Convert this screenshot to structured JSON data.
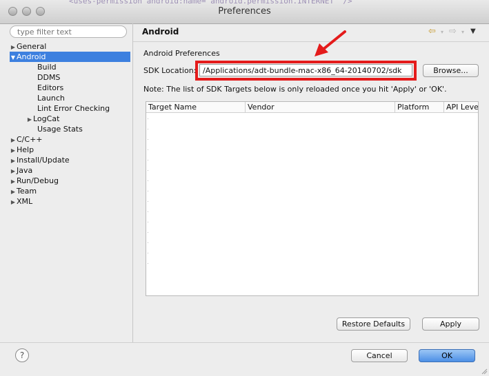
{
  "window": {
    "title": "Preferences",
    "background_code": "<uses-permission android:name=\"android.permission.INTERNET\" />"
  },
  "filter": {
    "placeholder": "type filter text"
  },
  "tree": [
    {
      "label": "General",
      "expander": "collapsed",
      "level": 0,
      "selected": false
    },
    {
      "label": "Android",
      "expander": "expanded",
      "level": 0,
      "selected": true
    },
    {
      "label": "Build",
      "expander": "none",
      "level": 1,
      "selected": false
    },
    {
      "label": "DDMS",
      "expander": "none",
      "level": 1,
      "selected": false
    },
    {
      "label": "Editors",
      "expander": "none",
      "level": 1,
      "selected": false
    },
    {
      "label": "Launch",
      "expander": "none",
      "level": 1,
      "selected": false
    },
    {
      "label": "Lint Error Checking",
      "expander": "none",
      "level": 1,
      "selected": false
    },
    {
      "label": "LogCat",
      "expander": "collapsed",
      "level": 1,
      "selected": false
    },
    {
      "label": "Usage Stats",
      "expander": "none",
      "level": 1,
      "selected": false
    },
    {
      "label": "C/C++",
      "expander": "collapsed",
      "level": 0,
      "selected": false
    },
    {
      "label": "Help",
      "expander": "collapsed",
      "level": 0,
      "selected": false
    },
    {
      "label": "Install/Update",
      "expander": "collapsed",
      "level": 0,
      "selected": false
    },
    {
      "label": "Java",
      "expander": "collapsed",
      "level": 0,
      "selected": false
    },
    {
      "label": "Run/Debug",
      "expander": "collapsed",
      "level": 0,
      "selected": false
    },
    {
      "label": "Team",
      "expander": "collapsed",
      "level": 0,
      "selected": false
    },
    {
      "label": "XML",
      "expander": "collapsed",
      "level": 0,
      "selected": false
    }
  ],
  "page": {
    "title": "Android",
    "section_label": "Android Preferences",
    "sdk_label": "SDK Location:",
    "sdk_value": "/Applications/adt-bundle-mac-x86_64-20140702/sdk",
    "browse_label": "Browse...",
    "note": "Note: The list of SDK Targets below is only reloaded once you hit 'Apply' or 'OK'.",
    "columns": [
      "Target Name",
      "Vendor",
      "Platform",
      "API Leve"
    ],
    "restore_label": "Restore Defaults",
    "apply_label": "Apply"
  },
  "footer": {
    "cancel_label": "Cancel",
    "ok_label": "OK",
    "help_glyph": "?"
  },
  "colors": {
    "selection": "#3d80df",
    "highlight": "#e41b1b",
    "primary_button": "#4c8fe6"
  }
}
